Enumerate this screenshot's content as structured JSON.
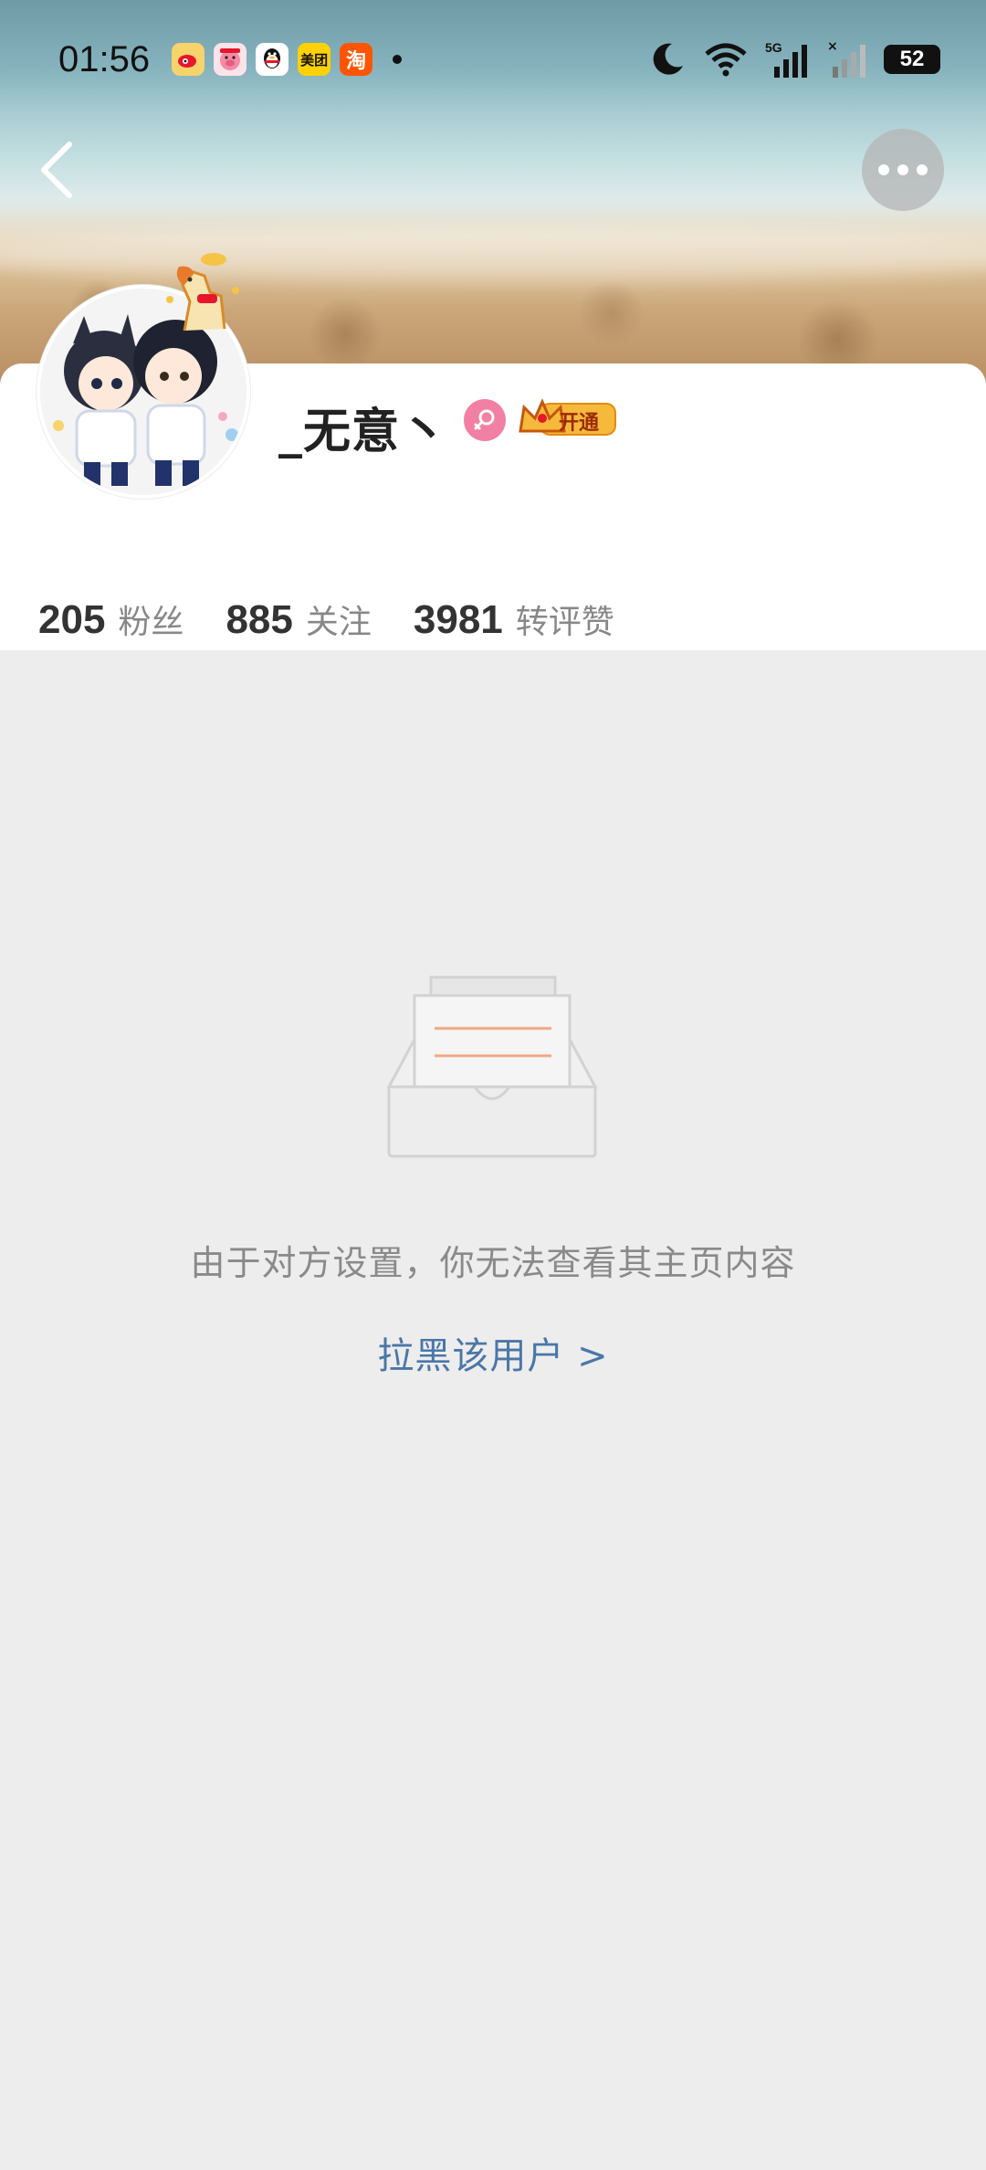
{
  "status_bar": {
    "time": "01:56",
    "app_icons": [
      "weibo-icon",
      "pig-app-icon",
      "qq-icon",
      "meituan-icon",
      "taobao-icon"
    ],
    "meituan_text": "美团",
    "taobao_text": "淘",
    "network": "5G",
    "battery": "52"
  },
  "profile": {
    "username": "_无意丶",
    "vip_label": "开通",
    "gender": "female",
    "stats": [
      {
        "number": "205",
        "label": "粉丝"
      },
      {
        "number": "885",
        "label": "关注"
      },
      {
        "number": "3981",
        "label": "转评赞"
      }
    ]
  },
  "empty_state": {
    "message": "由于对方设置，你无法查看其主页内容",
    "block_link": "拉黑该用户 >"
  },
  "colors": {
    "accent_link": "#4a77a8",
    "gender_badge": "#f27fa4",
    "vip_gold": "#f6b93b",
    "page_bg": "#ededed"
  }
}
